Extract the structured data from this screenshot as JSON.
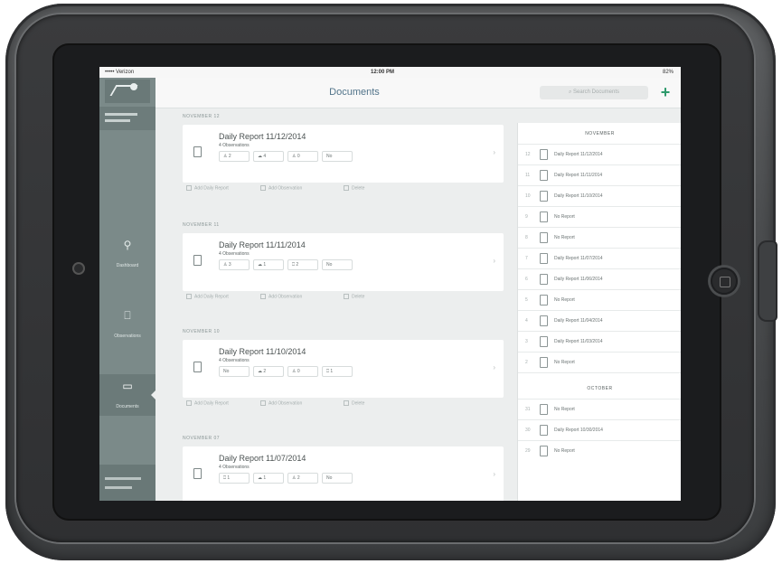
{
  "status_bar": {
    "carrier": "••••• Verizon",
    "time": "12:00 PM",
    "battery": "82%"
  },
  "sidebar": {
    "items": [
      {
        "label": "Dashboard",
        "icon": "chart-icon"
      },
      {
        "label": "Observations",
        "icon": "clipboard-icon"
      },
      {
        "label": "Documents",
        "icon": "folder-icon",
        "active": true
      }
    ]
  },
  "header": {
    "title": "Documents",
    "search_placeholder": "Search Documents",
    "add_label": "+"
  },
  "groups": [
    {
      "date": "NOVEMBER 12",
      "title": "Daily Report 11/12/2014",
      "observations": "4 Observations",
      "chips": [
        "2",
        "4",
        "0",
        "No"
      ]
    },
    {
      "date": "NOVEMBER 11",
      "title": "Daily Report 11/11/2014",
      "observations": "4 Observations",
      "chips": [
        "3",
        "1",
        "2",
        "No"
      ]
    },
    {
      "date": "NOVEMBER 10",
      "title": "Daily Report 11/10/2014",
      "observations": "4 Observations",
      "chips": [
        "No",
        "2",
        "0",
        "1"
      ]
    },
    {
      "date": "NOVEMBER 07",
      "title": "Daily Report 11/07/2014",
      "observations": "4 Observations",
      "chips": [
        "1",
        "1",
        "2",
        "No"
      ]
    }
  ],
  "card_actions": [
    "Add Daily Report",
    "Add Observation",
    "Delete"
  ],
  "right_panel": {
    "november_label": "NOVEMBER",
    "november_rows": [
      {
        "num": "12",
        "label": "Daily Report 11/12/2014"
      },
      {
        "num": "11",
        "label": "Daily Report 11/11/2014"
      },
      {
        "num": "10",
        "label": "Daily Report 11/10/2014"
      },
      {
        "num": "9",
        "label": "No Report"
      },
      {
        "num": "8",
        "label": "No Report"
      },
      {
        "num": "7",
        "label": "Daily Report 11/07/2014"
      },
      {
        "num": "6",
        "label": "Daily Report 11/06/2014"
      },
      {
        "num": "5",
        "label": "No Report"
      },
      {
        "num": "4",
        "label": "Daily Report 11/04/2014"
      },
      {
        "num": "3",
        "label": "Daily Report 11/03/2014"
      },
      {
        "num": "2",
        "label": "No Report"
      }
    ],
    "october_label": "OCTOBER",
    "october_rows": [
      {
        "num": "31",
        "label": "No Report"
      },
      {
        "num": "30",
        "label": "Daily Report 10/30/2014"
      },
      {
        "num": "29",
        "label": "No Report"
      }
    ]
  }
}
